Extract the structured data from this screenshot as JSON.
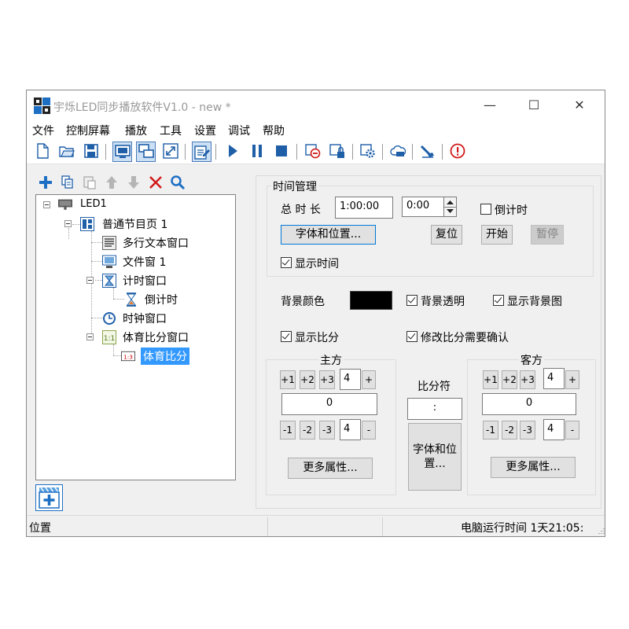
{
  "window": {
    "title": "宇烁LED同步播放软件V1.0 - new *",
    "minimize": "—",
    "maximize": "☐",
    "close": "✕"
  },
  "menu": [
    "文件",
    "控制屏幕",
    "播放",
    "工具",
    "设置",
    "调试",
    "帮助"
  ],
  "toolbar": {
    "icons": [
      "new-file-icon",
      "open-folder-icon",
      "save-icon",
      "screen-icon",
      "multi-screen-icon",
      "fullscreen-icon",
      "edit-icon",
      "play-icon",
      "pause-icon",
      "stop-icon",
      "cancel-icon",
      "lock-icon",
      "settings-icon",
      "cloud-icon",
      "broadcast-icon",
      "info-icon"
    ]
  },
  "tree_toolbar": {
    "icons": [
      "add-icon",
      "copy-icon",
      "paste-icon",
      "up-arrow-icon",
      "down-arrow-icon",
      "delete-icon",
      "search-icon"
    ]
  },
  "tree": {
    "root": "LED1",
    "page": "普通节目页 1",
    "items": {
      "multitext": "多行文本窗口",
      "file": "文件窗 1",
      "timer": "计时窗口",
      "countdown": "倒计时",
      "clock": "时钟窗口",
      "sports": "体育比分窗口",
      "sports_child": "体育比分"
    }
  },
  "time_mgmt": {
    "title": "时间管理",
    "duration_label": "总 时 长",
    "duration_value": "1:00:00",
    "time_value": "0:00",
    "countdown_label": "倒计时",
    "countdown_checked": false,
    "font_button": "字体和位置...",
    "reset_button": "复位",
    "start_button": "开始",
    "pause_button": "暂停",
    "show_time_label": "显示时间",
    "show_time_checked": true
  },
  "background": {
    "color_label": "背景颜色",
    "color": "#000000",
    "transparent_label": "背景透明",
    "transparent_checked": true,
    "show_image_label": "显示背景图",
    "show_image_checked": true
  },
  "score": {
    "show_score_label": "显示比分",
    "show_score_checked": true,
    "confirm_label": "修改比分需要确认",
    "confirm_checked": true,
    "separator_label": "比分符",
    "separator_value": ":",
    "font_button": "字体和位置...",
    "home": {
      "title": "主方",
      "plus": [
        "+1",
        "+2",
        "+3"
      ],
      "plus_step": "4",
      "plus_btn": "+",
      "value": "0",
      "minus": [
        "-1",
        "-2",
        "-3"
      ],
      "minus_step": "4",
      "minus_btn": "-",
      "more_button": "更多属性..."
    },
    "away": {
      "title": "客方",
      "plus": [
        "+1",
        "+2",
        "+3"
      ],
      "plus_step": "4",
      "plus_btn": "+",
      "value": "0",
      "minus": [
        "-1",
        "-2",
        "-3"
      ],
      "minus_step": "4",
      "minus_btn": "-",
      "more_button": "更多属性..."
    }
  },
  "status": {
    "position_label": "位置",
    "runtime": "电脑运行时间 1天21:05:"
  },
  "colors": {
    "accent": "#1d6fc4",
    "selection": "#3399ff",
    "delete": "#d11a1a"
  }
}
